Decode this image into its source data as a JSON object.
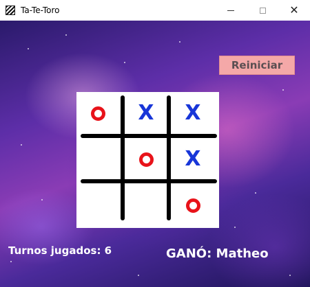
{
  "window": {
    "title": "Ta-Te-Toro",
    "minimize_glyph": "",
    "close_glyph": "✕"
  },
  "game": {
    "restart_label": "Reiniciar",
    "turns_text": "Turnos jugados: 6",
    "winner_text": "GANÓ: Matheo"
  },
  "board": {
    "cells": [
      "O",
      "X",
      "X",
      "",
      "O",
      "X",
      "",
      "",
      "O"
    ]
  },
  "colors": {
    "o_color": "#e8131a",
    "x_color": "#1836d8",
    "restart_bg": "#f4a8a8"
  }
}
